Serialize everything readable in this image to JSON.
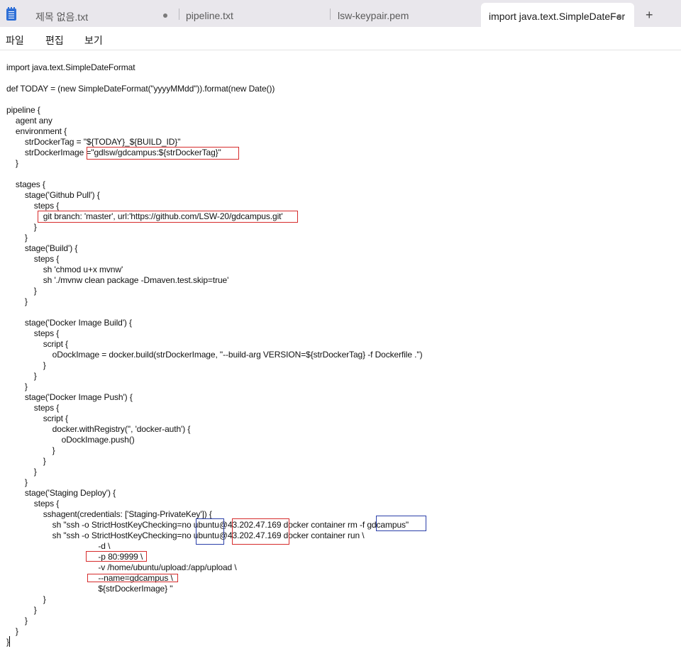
{
  "tabs": [
    {
      "label": "제목 없음.txt",
      "modified": true,
      "active": false
    },
    {
      "label": "pipeline.txt",
      "modified": false,
      "active": false
    },
    {
      "label": "lsw-keypair.pem",
      "modified": false,
      "active": false
    },
    {
      "label": "import java.text.SimpleDateFor",
      "modified": true,
      "active": true
    }
  ],
  "new_tab_label": "+",
  "menu": {
    "file": "파일",
    "edit": "편집",
    "view": "보기"
  },
  "icons": {
    "app": "notepad-icon",
    "modified": "unsaved-dot-icon",
    "new_tab": "plus-icon"
  },
  "colors": {
    "highlight_red": "#d62b2b",
    "highlight_blue": "#2b3fa8",
    "tabbar_bg": "#e9e7ec"
  },
  "editor_lines": [
    "import java.text.SimpleDateFormat",
    "",
    "def TODAY = (new SimpleDateFormat(\"yyyyMMdd\")).format(new Date())",
    "",
    "pipeline {",
    "    agent any",
    "    environment {",
    "        strDockerTag = \"${TODAY}_${BUILD_ID}\"",
    "        strDockerImage =\"gdlsw/gdcampus:${strDockerTag}\"",
    "    }",
    "",
    "    stages {",
    "        stage('Github Pull') {",
    "            steps {",
    "                git branch: 'master', url:'https://github.com/LSW-20/gdcampus.git'",
    "            }",
    "        }",
    "        stage('Build') {",
    "            steps {",
    "                sh 'chmod u+x mvnw'",
    "                sh './mvnw clean package -Dmaven.test.skip=true'",
    "            }",
    "        }",
    "",
    "        stage('Docker Image Build') {",
    "            steps {",
    "                script {",
    "                    oDockImage = docker.build(strDockerImage, \"--build-arg VERSION=${strDockerTag} -f Dockerfile .\")",
    "                }",
    "            }",
    "        }",
    "        stage('Docker Image Push') {",
    "            steps {",
    "                script {",
    "                    docker.withRegistry('', 'docker-auth') {",
    "                        oDockImage.push()",
    "                    }",
    "                }",
    "            }",
    "        }",
    "        stage('Staging Deploy') {",
    "            steps {",
    "                sshagent(credentials: ['Staging-PrivateKey']) {",
    "                    sh \"ssh -o StrictHostKeyChecking=no ubuntu@43.202.47.169 docker container rm -f gdcampus\"",
    "                    sh \"ssh -o StrictHostKeyChecking=no ubuntu@43.202.47.169 docker container run \\",
    "                                        -d \\",
    "                                        -p 80:9999 \\",
    "                                        -v /home/ubuntu/upload:/app/upload \\",
    "                                        --name=gdcampus \\",
    "                                        ${strDockerImage} \"",
    "                }",
    "            }",
    "        }",
    "    }",
    "}"
  ]
}
